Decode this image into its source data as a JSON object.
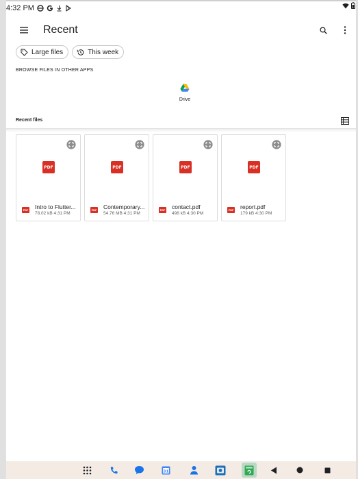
{
  "status_bar": {
    "time": "4:32 PM",
    "icons": [
      "vpn-icon",
      "google-icon",
      "download-icon",
      "play-store-icon"
    ],
    "right_icons": [
      "wifi-icon",
      "battery-icon"
    ]
  },
  "app_bar": {
    "title": "Recent",
    "actions": [
      "search-icon",
      "more-vert-icon"
    ]
  },
  "filters": [
    {
      "label": "Large files",
      "icon": "label-icon"
    },
    {
      "label": "This week",
      "icon": "history-icon"
    }
  ],
  "browse_section": {
    "heading": "BROWSE FILES IN OTHER APPS",
    "apps": [
      {
        "label": "Drive",
        "icon": "google-drive-icon"
      }
    ]
  },
  "recent_files": {
    "heading": "Recent files",
    "view_toggle_icon": "list-view-icon",
    "files": [
      {
        "name": "Intro to Flutter...",
        "meta": "78.02 kB 4:31 PM",
        "thumb": "PDF",
        "badge": "PDF"
      },
      {
        "name": "Contemporary...",
        "meta": "54.76 MB 4:31 PM",
        "thumb": "PDF",
        "badge": "PDF"
      },
      {
        "name": "contact.pdf",
        "meta": "498 kB 4:30 PM",
        "thumb": "PDF",
        "badge": "PDF"
      },
      {
        "name": "report.pdf",
        "meta": "179 kB 4:30 PM",
        "thumb": "PDF",
        "badge": "PDF"
      }
    ]
  },
  "nav_bar": {
    "items": [
      "app-drawer-icon",
      "phone-icon",
      "messages-icon",
      "calendar-icon",
      "contacts-icon",
      "camera-icon",
      "files-icon",
      "back-icon",
      "home-icon",
      "recents-icon"
    ]
  },
  "colors": {
    "pdf_red": "#d93025",
    "nav_background": "#f4ece4",
    "chip_border": "#c8c8c8"
  }
}
